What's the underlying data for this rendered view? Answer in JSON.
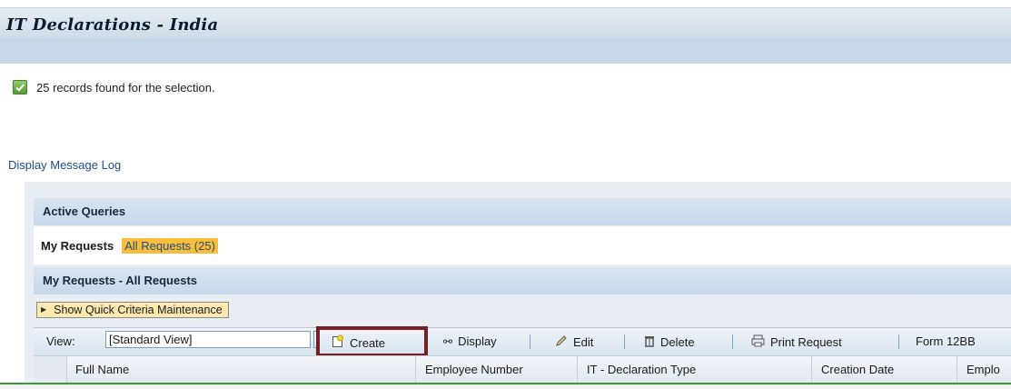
{
  "page": {
    "title": "IT Declarations - India"
  },
  "status": {
    "message": "25 records found for the selection.",
    "icon": "check-icon"
  },
  "links": {
    "message_log": "Display Message Log"
  },
  "active_queries": {
    "header": "Active Queries",
    "my_requests_label": "My Requests",
    "all_requests_link": "All Requests (25)"
  },
  "results": {
    "header": "My Requests - All Requests",
    "quick_criteria_label": "Show Quick Criteria Maintenance"
  },
  "toolbar": {
    "view_label": "View:",
    "view_value": "[Standard View]",
    "create_label": "Create",
    "display_label": "Display",
    "edit_label": "Edit",
    "delete_label": "Delete",
    "print_label": "Print Request",
    "form_label": "Form 12BB"
  },
  "table": {
    "columns": [
      "Full Name",
      "Employee Number",
      "IT - Declaration Type",
      "Creation Date",
      "Emplo"
    ]
  },
  "colors": {
    "highlight": "#f8bd3a",
    "create_outline": "#7a1d24",
    "link": "#1f4f86"
  }
}
